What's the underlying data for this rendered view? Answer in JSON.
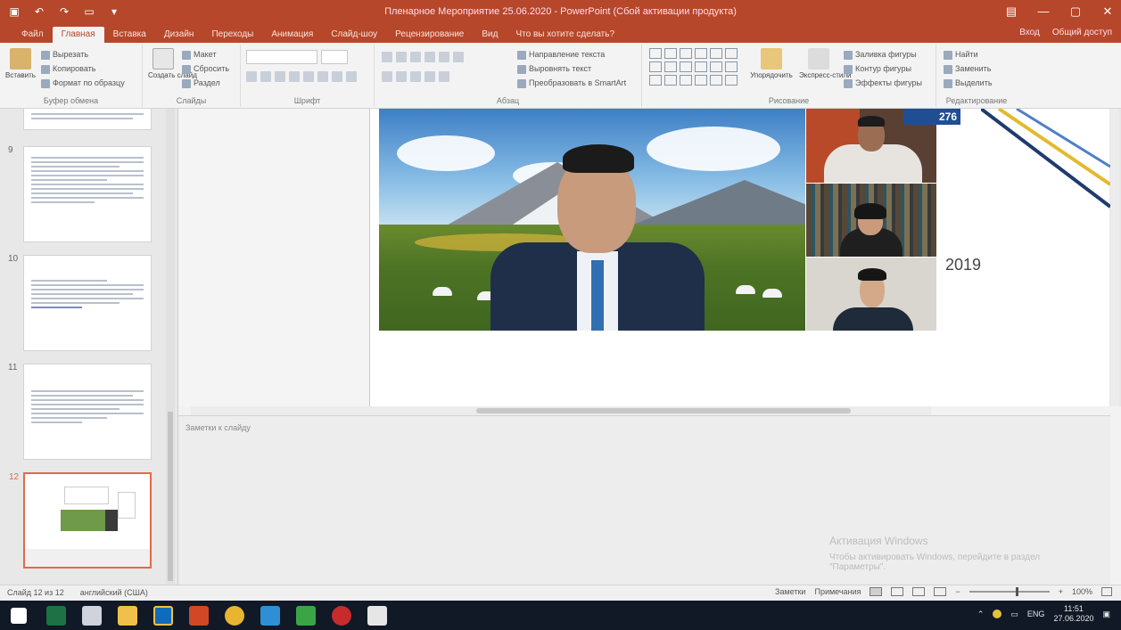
{
  "app": {
    "title": "Пленарное Мероприятие 25.06.2020 - PowerPoint (Сбой активации продукта)",
    "qat": [
      "save-icon",
      "undo-icon",
      "redo-icon",
      "present-icon",
      "customize-icon"
    ],
    "window_controls": [
      "—",
      "▢",
      "✕"
    ]
  },
  "ribbon": {
    "tabs": [
      "Файл",
      "Главная",
      "Вставка",
      "Дизайн",
      "Переходы",
      "Анимация",
      "Слайд-шоу",
      "Рецензирование",
      "Вид",
      "Что вы хотите сделать?"
    ],
    "active_tab": "Главная",
    "right_items": [
      "Вход",
      "Общий доступ"
    ],
    "groups": {
      "clipboard": {
        "label": "Буфер обмена",
        "paste": "Вставить",
        "cut": "Вырезать",
        "copy": "Копировать",
        "format": "Формат по образцу"
      },
      "slides": {
        "label": "Слайды",
        "new_slide": "Создать слайд",
        "layout": "Макет",
        "reset": "Сбросить",
        "section": "Раздел"
      },
      "font": {
        "label": "Шрифт"
      },
      "paragraph": {
        "label": "Абзац",
        "direction": "Направление текста",
        "align": "Выровнять текст",
        "smartart": "Преобразовать в SmartArt"
      },
      "drawing": {
        "label": "Рисование",
        "arrange": "Упорядочить",
        "styles": "Экспресс-стили",
        "fill": "Заливка фигуры",
        "outline": "Контур фигуры",
        "effects": "Эффекты фигуры"
      },
      "editing": {
        "label": "Редактирование",
        "find": "Найти",
        "replace": "Заменить",
        "select": "Выделить"
      }
    }
  },
  "thumbnails": [
    {
      "num": "",
      "lines": 2
    },
    {
      "num": "9",
      "lines": 14
    },
    {
      "num": "10",
      "lines": 8
    },
    {
      "num": "11",
      "lines": 9
    },
    {
      "num": "12",
      "lines": 3,
      "selected": true
    }
  ],
  "slide": {
    "badge": "276",
    "year": "2019"
  },
  "notes": {
    "placeholder": "Заметки к слайду"
  },
  "activation": {
    "line1": "Активация Windows",
    "line2": "Чтобы активировать Windows, перейдите в раздел",
    "line3": "\"Параметры\"."
  },
  "status": {
    "slide_counter": "Слайд 12 из 12",
    "language": "английский (США)",
    "notes": "Заметки",
    "comments": "Примечания",
    "zoom": "100%"
  },
  "taskbar": {
    "apps": [
      "start-icon",
      "excel-icon",
      "calculator-icon",
      "explorer-icon",
      "outlook-icon",
      "powerpoint-icon",
      "chrome-icon",
      "file-manager-icon",
      "media-icon",
      "opera-icon",
      "app-icon"
    ],
    "language": "ENG",
    "time": "11:51",
    "date": "27.06.2020"
  },
  "colors": {
    "accent": "#b7472a",
    "slide_badge": "#1f4e94",
    "selected_thumb": "#e06b47"
  }
}
